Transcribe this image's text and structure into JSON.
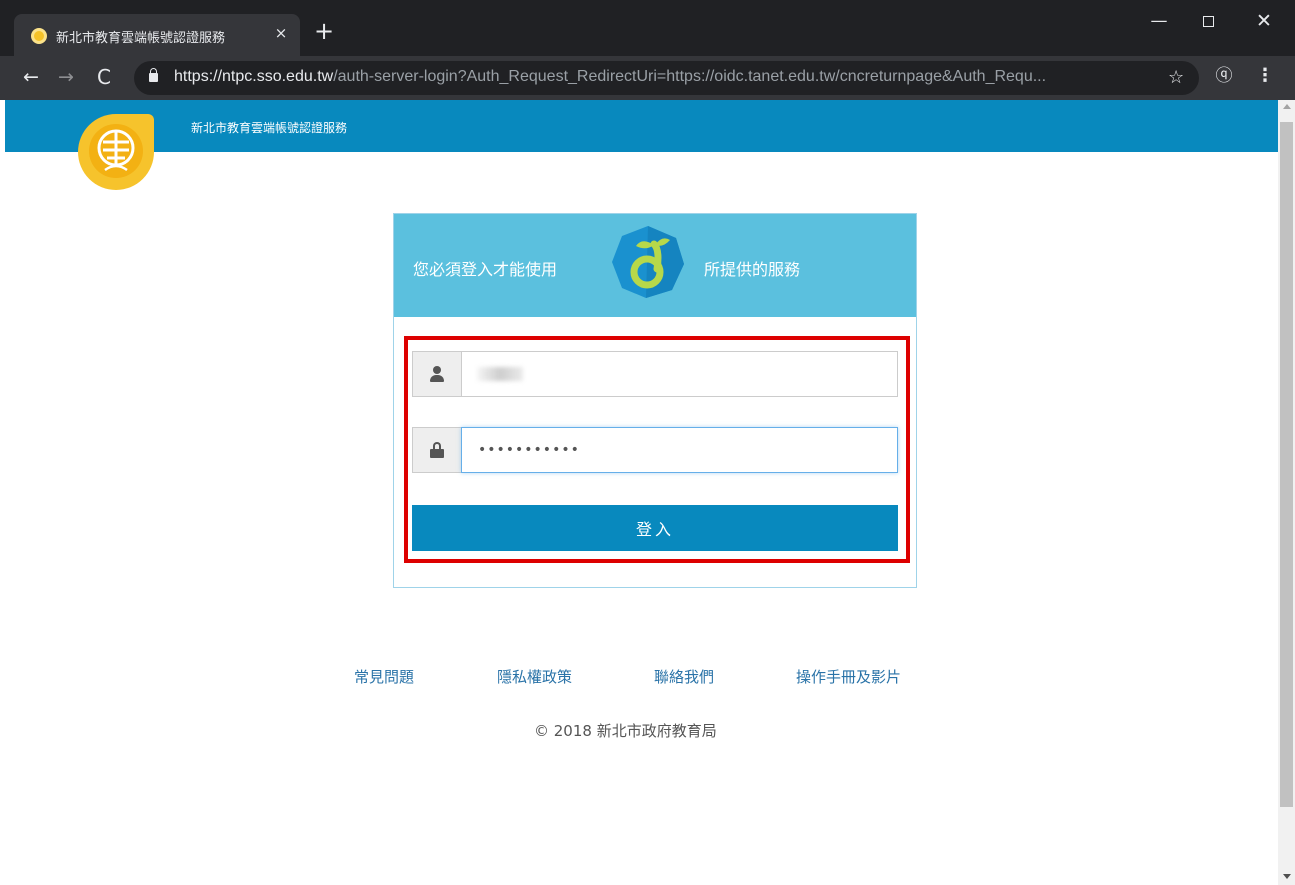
{
  "browser": {
    "tab_title": "新北市教育雲端帳號認證服務",
    "tab_close": "×",
    "new_tab": "+",
    "url_host": "https://ntpc.sso.edu.tw",
    "url_path": "/auth-server-login?Auth_Request_RedirectUri=https://oidc.tanet.edu.tw/cncreturnpage&Auth_Requ...",
    "window_controls": {
      "minimize": "—",
      "close": "✕"
    },
    "nav": {
      "back": "←",
      "forward": "→",
      "reload": "C"
    },
    "icons": [
      "lock-icon",
      "star-icon",
      "extension-icon",
      "menu-icon"
    ],
    "star": "☆",
    "extension": "ⓠ",
    "menu": "⋮"
  },
  "site": {
    "title": "新北市教育雲端帳號認證服務",
    "header_color": "#0889be"
  },
  "login": {
    "prompt_before": "您必須登入才能使用",
    "prompt_after": "所提供的服務",
    "username_value": "",
    "password_value": "•••••••••••",
    "submit_label": "登入",
    "highlight_color": "#dd0000"
  },
  "footer": {
    "links": [
      "常見問題",
      "隱私權政策",
      "聯絡我們",
      "操作手冊及影片"
    ],
    "copyright": "© 2018 新北市政府教育局"
  }
}
